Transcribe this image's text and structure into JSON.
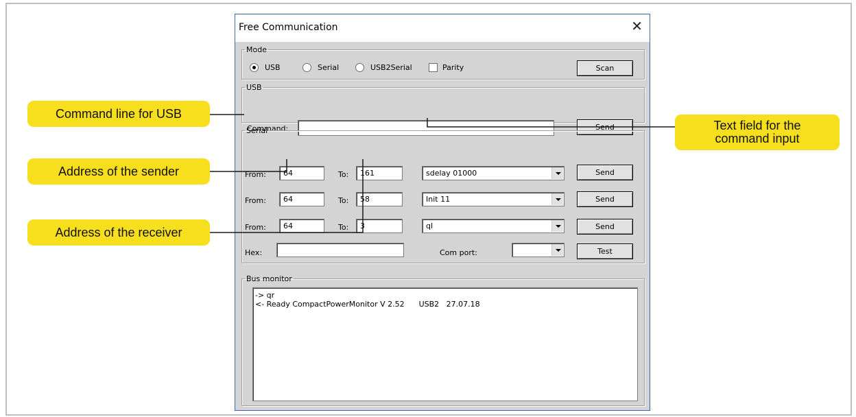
{
  "window": {
    "title": "Free Communication",
    "close_glyph": "✕"
  },
  "mode": {
    "legend": "Mode",
    "options": [
      "USB",
      "Serial",
      "USB2Serial"
    ],
    "selected": "USB",
    "parity_label": "Parity",
    "parity_checked": false,
    "scan_label": "Scan"
  },
  "usb": {
    "legend": "USB",
    "command_label": "Command:",
    "command_value": "",
    "send_label": "Send"
  },
  "serial": {
    "legend": "Serial",
    "from_label": "From:",
    "to_label": "To:",
    "rows": [
      {
        "from": "64",
        "to": "161",
        "command": "sdelay 01000",
        "send": "Send"
      },
      {
        "from": "64",
        "to": "58",
        "command": "Init 11",
        "send": "Send"
      },
      {
        "from": "64",
        "to": "3",
        "command": "ql",
        "send": "Send"
      }
    ],
    "hex_label": "Hex:",
    "hex_value": "",
    "comport_label": "Com port:",
    "comport_value": "",
    "test_label": "Test"
  },
  "bus_monitor": {
    "legend": "Bus monitor",
    "lines": [
      "-> qr",
      "<- Ready CompactPowerMonitor V 2.52      USB2   27.07.18"
    ]
  },
  "callouts": {
    "command_line_usb": "Command line for USB",
    "sender_address": "Address of the sender",
    "receiver_address": "Address of the receiver",
    "text_field_command": "Text field for the command input"
  },
  "colors": {
    "callout": "#f7df1e",
    "window_border": "#2f6db7",
    "dialog_bg": "#d4d4d4"
  }
}
